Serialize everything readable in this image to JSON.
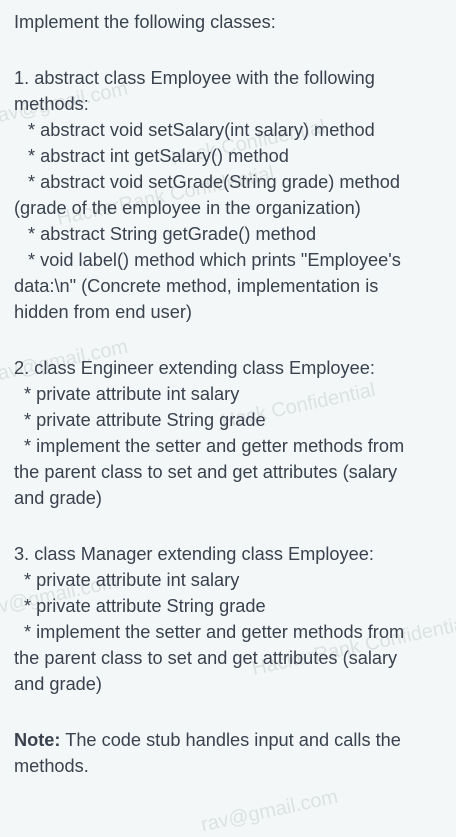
{
  "intro": "Implement the following classes:",
  "section1": {
    "lines": [
      "1. abstract class Employee with the following",
      "methods:",
      "* abstract void setSalary(int salary) method",
      "* abstract int getSalary() method",
      "* abstract void setGrade(String grade) method",
      "(grade of the employee in the organization)",
      "* abstract String getGrade() method",
      "* void label() method which prints \"Employee's",
      "data:\\n\" (Concrete method, implementation is",
      "hidden from end user)"
    ]
  },
  "section2": {
    "lines": [
      "2. class Engineer extending class Employee:",
      "* private attribute int salary",
      "* private attribute String grade",
      "* implement the setter and getter methods from",
      "the parent class to set and get attributes (salary",
      "and grade)"
    ]
  },
  "section3": {
    "lines": [
      "3. class Manager extending class Employee:",
      "* private attribute int salary",
      "* private attribute String grade",
      "* implement the setter and getter methods from",
      "the parent class to set and get attributes (salary",
      "and grade)"
    ]
  },
  "note": {
    "label": "Note:",
    "line1": " The code stub handles input and calls the",
    "line2": "methods."
  },
  "watermarks": [
    "rav@gmail.com",
    "Hack Confidential",
    "HackerRank Confidential",
    "rav@gmail.com",
    "Hack Confidential",
    "HackerRank Confidential",
    "rav@gmail.com",
    "rav@gmail.com"
  ]
}
